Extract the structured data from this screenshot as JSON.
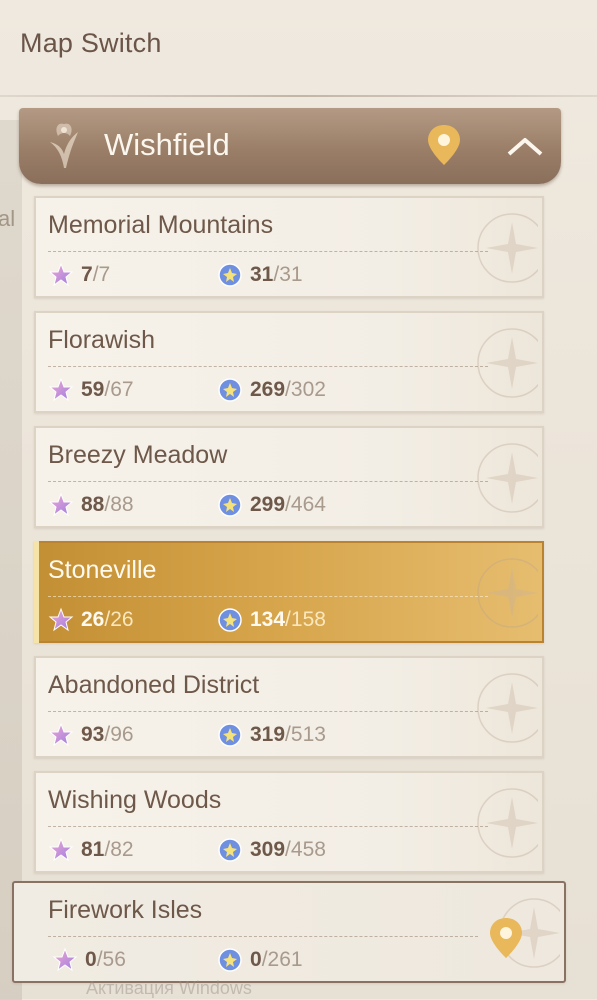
{
  "header": {
    "title": "Map Switch"
  },
  "side": {
    "partial_label": "al"
  },
  "region": {
    "name": "Wishfield"
  },
  "areas": [
    {
      "name": "Memorial Mountains",
      "a_cur": "7",
      "a_tot": "7",
      "b_cur": "31",
      "b_tot": "31"
    },
    {
      "name": "Florawish",
      "a_cur": "59",
      "a_tot": "67",
      "b_cur": "269",
      "b_tot": "302"
    },
    {
      "name": "Breezy Meadow",
      "a_cur": "88",
      "a_tot": "88",
      "b_cur": "299",
      "b_tot": "464"
    },
    {
      "name": "Stoneville",
      "a_cur": "26",
      "a_tot": "26",
      "b_cur": "134",
      "b_tot": "158",
      "selected": true
    },
    {
      "name": "Abandoned District",
      "a_cur": "93",
      "a_tot": "96",
      "b_cur": "319",
      "b_tot": "513"
    },
    {
      "name": "Wishing Woods",
      "a_cur": "81",
      "a_tot": "82",
      "b_cur": "309",
      "b_tot": "458"
    },
    {
      "name": "Firework Isles",
      "a_cur": "0",
      "a_tot": "56",
      "b_cur": "0",
      "b_tot": "261",
      "current_location": true
    }
  ],
  "separator": "/",
  "watermark": "Активация Windows",
  "icons": {
    "region_emblem": "flower-emblem-icon",
    "region_pin": "location-pin-icon",
    "collapse": "chevron-up-icon",
    "stat_a": "star-collectible-icon",
    "stat_b": "orb-collectible-icon"
  },
  "colors": {
    "region_bar": "#9a7e68",
    "selected_card": "#d6a44a",
    "pin": "#e8b85a",
    "text": "#6e584a"
  }
}
